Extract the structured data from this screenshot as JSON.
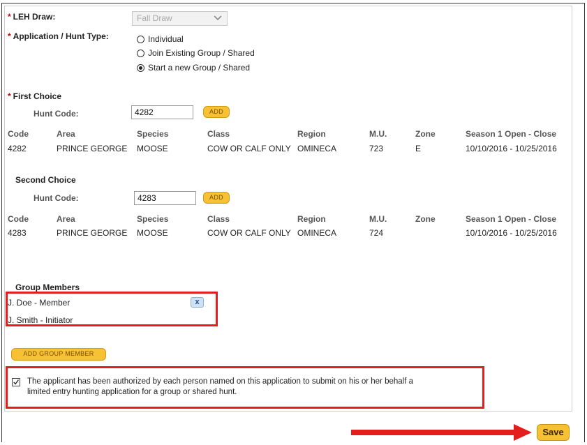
{
  "leh": {
    "label": "LEH Draw:",
    "selected": "Fall Draw"
  },
  "application": {
    "label": "Application / Hunt Type:",
    "options": [
      "Individual",
      "Join Existing Group / Shared",
      "Start a new Group / Shared"
    ],
    "selected_index": 2
  },
  "first_choice": {
    "heading": "First Choice",
    "hunt_code_label": "Hunt Code:",
    "hunt_code_value": "4282",
    "add_label": "ADD",
    "columns": [
      "Code",
      "Area",
      "Species",
      "Class",
      "Region",
      "M.U.",
      "Zone",
      "Season 1 Open - Close"
    ],
    "row": {
      "code": "4282",
      "area": "PRINCE GEORGE",
      "species": "MOOSE",
      "class": "COW OR CALF ONLY",
      "region": "OMINECA",
      "mu": "723",
      "zone": "E",
      "season": "10/10/2016 - 10/25/2016"
    }
  },
  "second_choice": {
    "heading": "Second Choice",
    "hunt_code_label": "Hunt Code:",
    "hunt_code_value": "4283",
    "add_label": "ADD",
    "columns": [
      "Code",
      "Area",
      "Species",
      "Class",
      "Region",
      "M.U.",
      "Zone",
      "Season 1 Open - Close"
    ],
    "row": {
      "code": "4283",
      "area": "PRINCE GEORGE",
      "species": "MOOSE",
      "class": "COW OR CALF ONLY",
      "region": "OMINECA",
      "mu": "724",
      "zone": "",
      "season": "10/10/2016 - 10/25/2016"
    }
  },
  "group": {
    "heading": "Group Members",
    "members": [
      "J. Doe - Member",
      "J. Smith - Initiator"
    ],
    "remove_label": "x",
    "add_member_label": "ADD GROUP MEMBER"
  },
  "authorization": {
    "checked": true,
    "line1": "The applicant has been authorized by each person named on this application to submit on his or her behalf a",
    "line2": "limited entry hunting application for a group or shared hunt."
  },
  "save_label": "Save",
  "colors": {
    "accent_yellow": "#f6c233",
    "highlight_red": "#e41d1d",
    "required_red": "#cc0000",
    "remove_blue": "#cfe2f5"
  }
}
